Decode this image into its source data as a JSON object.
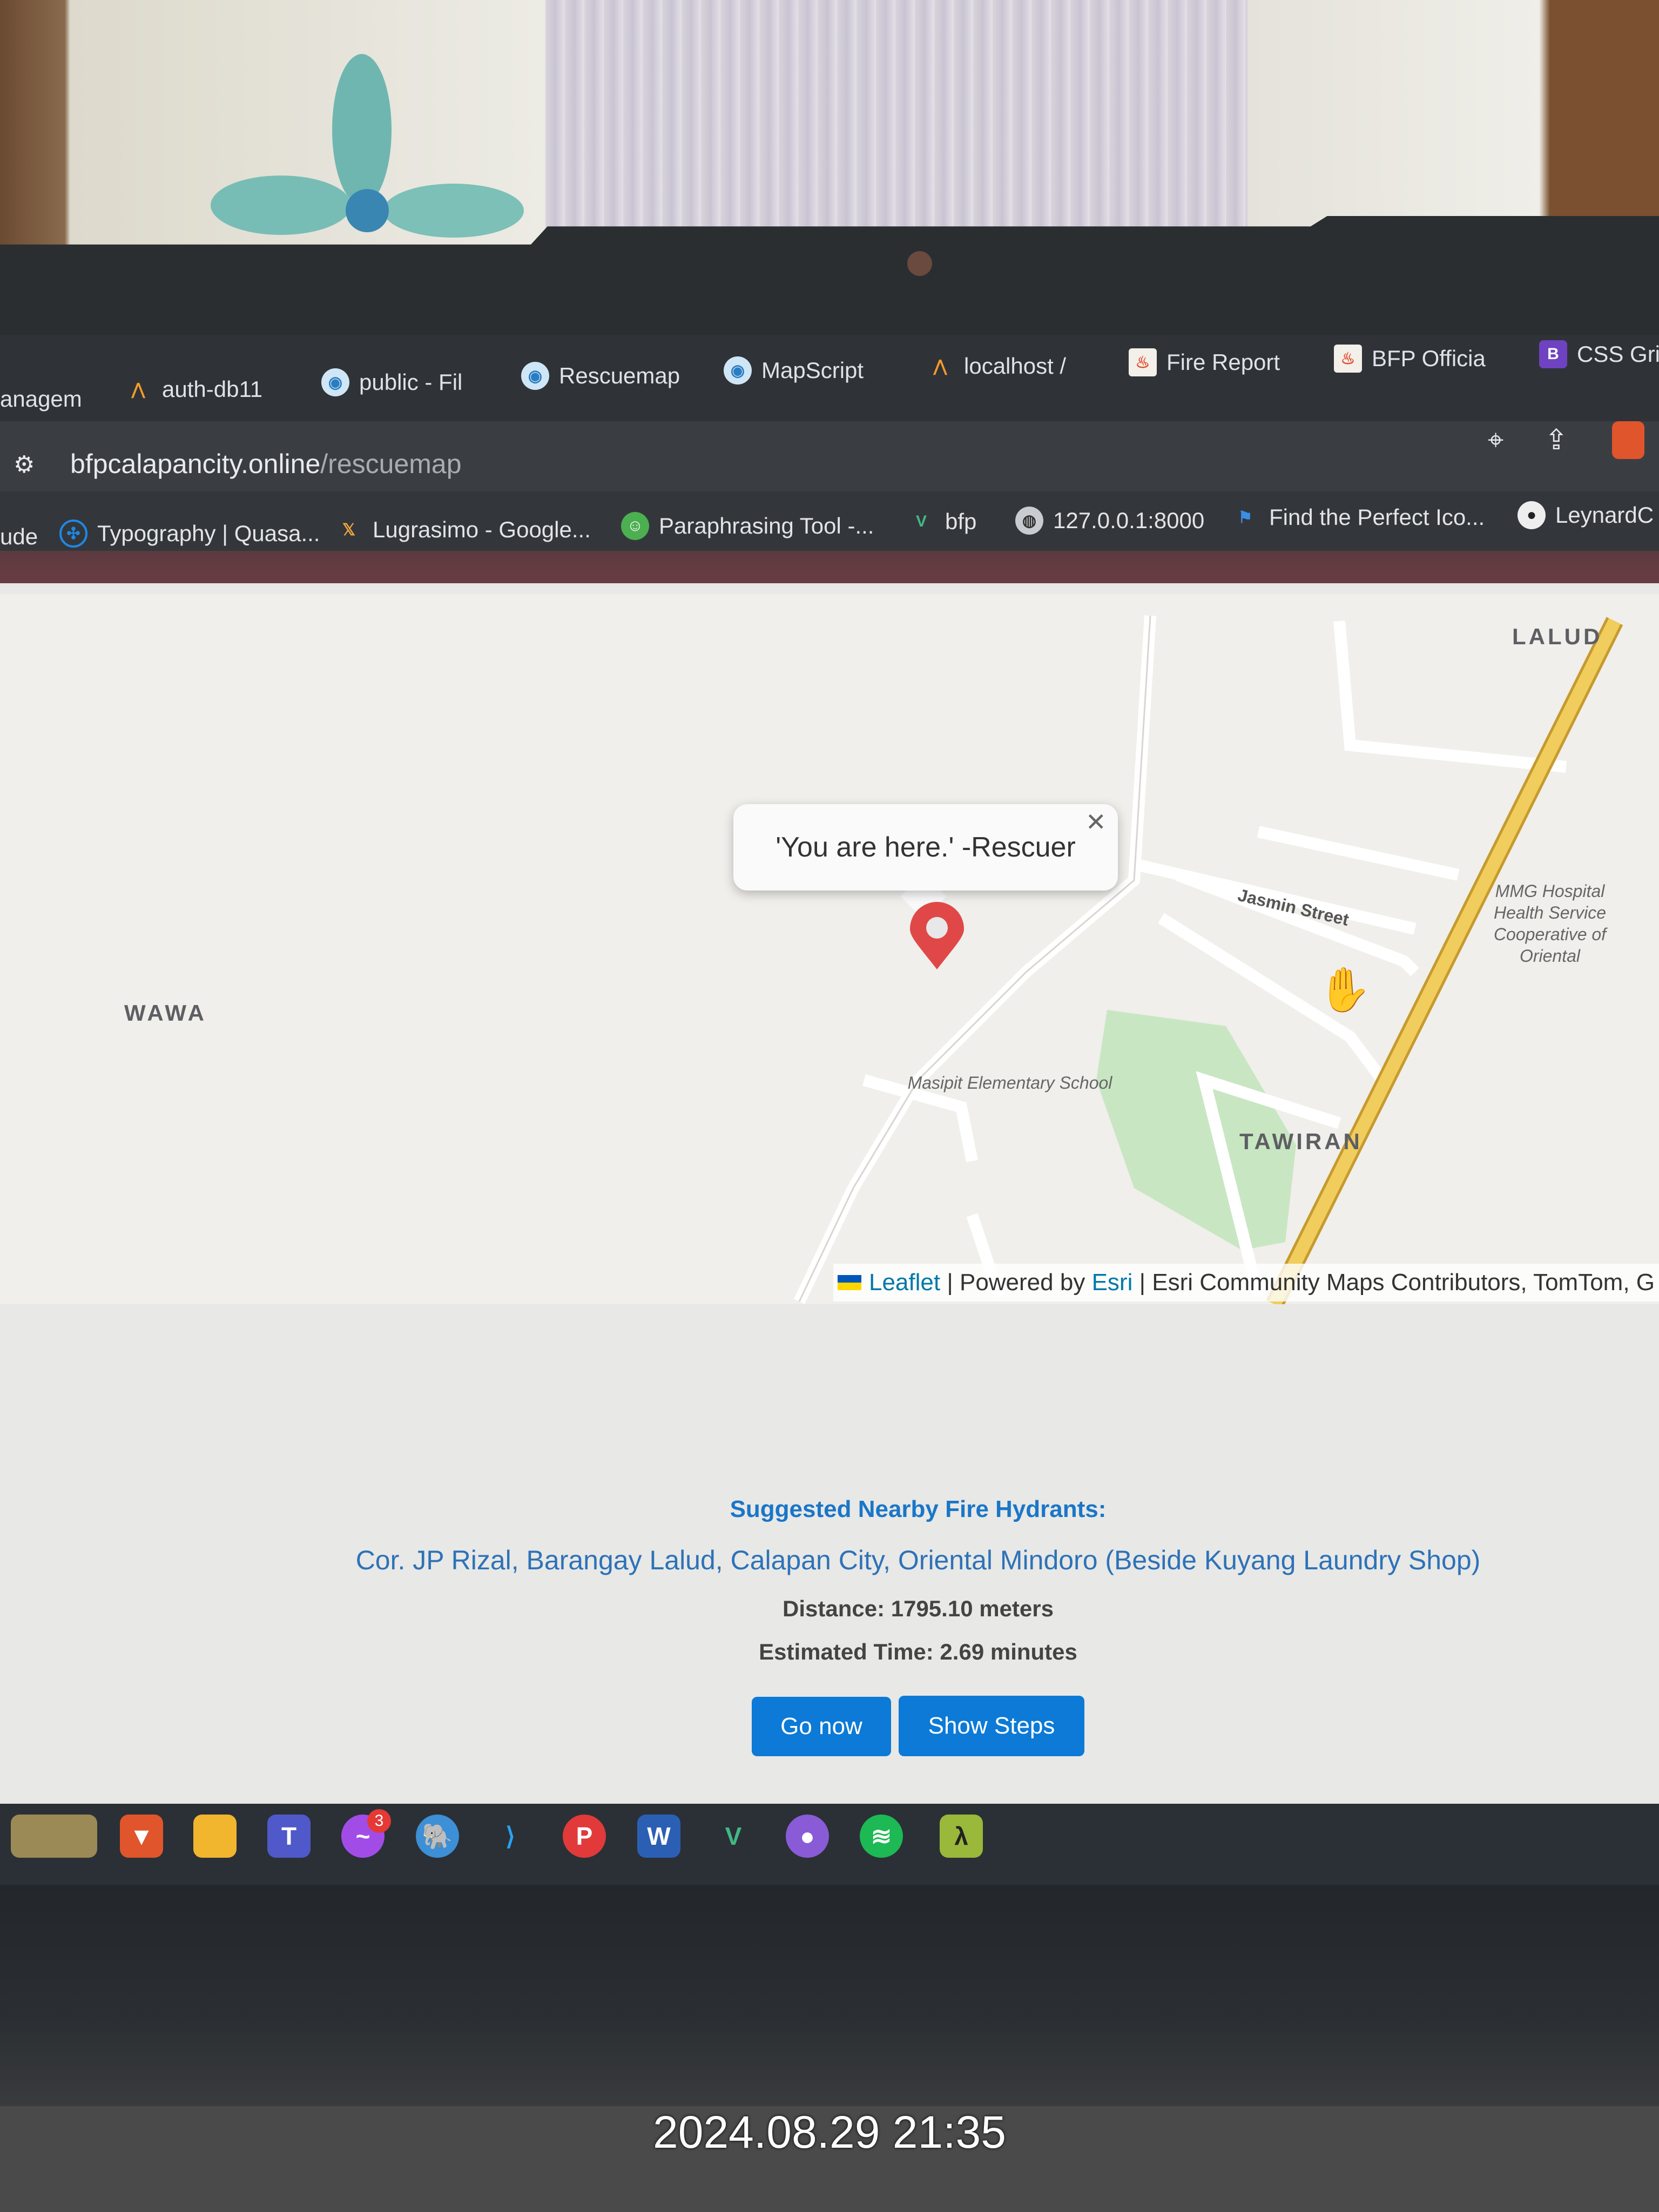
{
  "browser": {
    "tabs": [
      {
        "label": "anagem",
        "icon": "tab-icon"
      },
      {
        "label": "auth-db11",
        "icon": "phpmyadmin-icon"
      },
      {
        "label": "public - Fil",
        "icon": "globe-icon"
      },
      {
        "label": "Rescuemap",
        "icon": "globe-icon"
      },
      {
        "label": "MapScript",
        "icon": "globe-icon"
      },
      {
        "label": "localhost /",
        "icon": "phpmyadmin-icon"
      },
      {
        "label": "Fire Report",
        "icon": "codeigniter-icon"
      },
      {
        "label": "BFP Officia",
        "icon": "codeigniter-icon"
      },
      {
        "label": "CSS Gri",
        "icon": "bootstrap-icon"
      }
    ],
    "address": {
      "domain": "bfpcalapancity.online",
      "path": "/rescuemap"
    },
    "bookmarks": [
      {
        "label": "ude"
      },
      {
        "label": "Typography | Quasa..."
      },
      {
        "label": "Lugrasimo - Google..."
      },
      {
        "label": "Paraphrasing Tool -..."
      },
      {
        "label": "bfp"
      },
      {
        "label": "127.0.0.1:8000"
      },
      {
        "label": "Find the Perfect Ico..."
      },
      {
        "label": "LeynardC"
      }
    ]
  },
  "map": {
    "popup_text": "'You are here.' -Rescuer",
    "labels": {
      "lalud": "LALUD",
      "wawa": "WAWA",
      "tawiran": "TAWIRAN",
      "street": "Jasmin Street"
    },
    "poi": {
      "school": "Masipit Elementary School",
      "hospital": "MMG Hospital Health Service Cooperative of Oriental"
    },
    "attribution": {
      "leaflet": "Leaflet",
      "powered": "| Powered by",
      "esri": "Esri",
      "rest": "| Esri Community Maps Contributors, TomTom, G"
    },
    "colors": {
      "marker": "#e04848",
      "highway": "#e8c35a",
      "park": "#c9e6c3"
    }
  },
  "hydrants": {
    "heading": "Suggested Nearby Fire Hydrants:",
    "address": "Cor. JP Rizal, Barangay Lalud, Calapan City, Oriental Mindoro (Beside Kuyang Laundry Shop)",
    "distance": "Distance: 1795.10 meters",
    "time": "Estimated Time: 2.69 minutes",
    "go_now": "Go now",
    "show_steps": "Show Steps",
    "accent": "#0c7ad6"
  },
  "taskbar": {
    "messenger_badge": "3"
  },
  "timestamp": "2024.08.29 21:35"
}
